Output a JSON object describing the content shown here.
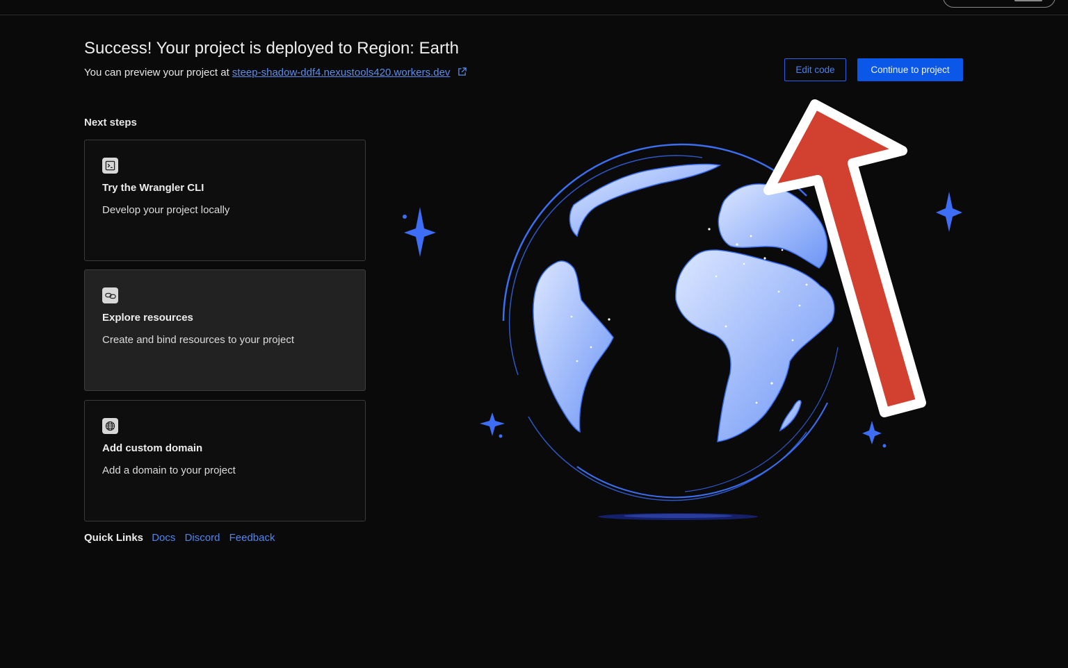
{
  "header": {
    "title": "Success! Your project is deployed to Region: Earth",
    "preview_prefix": "You can preview your project at",
    "preview_link": "steep-shadow-ddf4.nexustools420.workers.dev",
    "preview_link_icon": "external-link-icon"
  },
  "actions": {
    "edit_code": "Edit code",
    "continue": "Continue to project"
  },
  "next_steps": {
    "heading": "Next steps",
    "cards": [
      {
        "title": "Try the Wrangler CLI",
        "description": "Develop your project locally",
        "icon": "terminal-icon"
      },
      {
        "title": "Explore resources",
        "description": "Create and bind resources to your project",
        "icon": "link-icon"
      },
      {
        "title": "Add custom domain",
        "description": "Add a domain to your project",
        "icon": "globe-icon"
      }
    ]
  },
  "quick_links": {
    "label": "Quick Links",
    "links": [
      "Docs",
      "Discord",
      "Feedback"
    ]
  },
  "colors": {
    "background": "#0a0a0a",
    "accent": "#0a57e8",
    "link": "#4f86f0",
    "annotation_arrow": "#d2402f"
  }
}
